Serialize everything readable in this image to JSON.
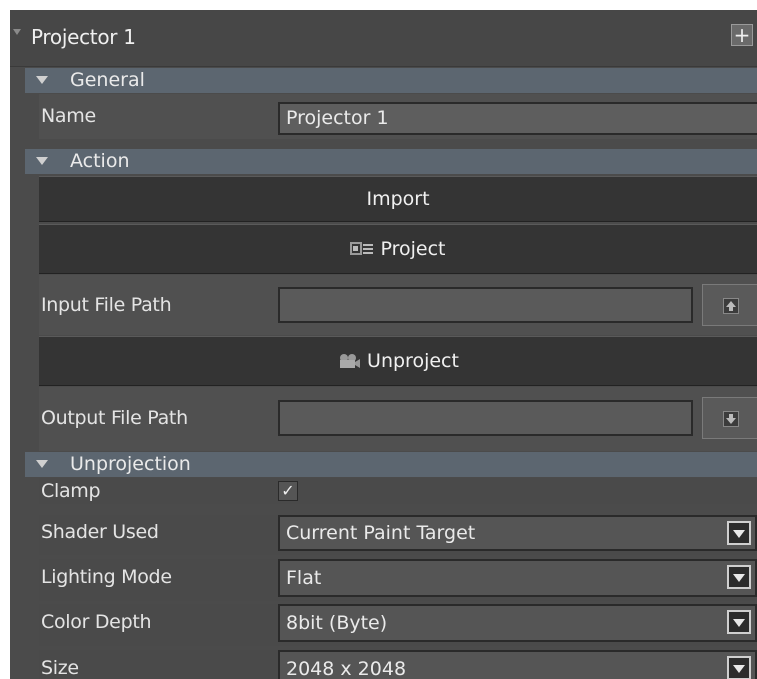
{
  "panel": {
    "title": "Projector 1",
    "add_label": "+"
  },
  "sections": {
    "general": "General",
    "action": "Action",
    "unprojection": "Unprojection"
  },
  "general": {
    "name_label": "Name",
    "name_value": "Projector 1"
  },
  "action": {
    "import_label": "Import",
    "project_label": "Project",
    "input_path_label": "Input File Path",
    "input_path_value": "",
    "unproject_label": "Unproject",
    "output_path_label": "Output File Path",
    "output_path_value": ""
  },
  "unprojection": {
    "clamp_label": "Clamp",
    "clamp_checked": true,
    "clamp_mark": "✓",
    "shader_label": "Shader Used",
    "shader_value": "Current Paint Target",
    "lighting_label": "Lighting Mode",
    "lighting_value": "Flat",
    "depth_label": "Color Depth",
    "depth_value": "8bit (Byte)",
    "size_label": "Size",
    "size_value": "2048 x 2048"
  },
  "icons": {
    "section_toggle": "triangle-down-icon",
    "project": "projector-icon",
    "unproject": "camera-icon",
    "upload": "upload-icon",
    "download": "download-icon",
    "dropdown": "chevron-down-icon"
  }
}
